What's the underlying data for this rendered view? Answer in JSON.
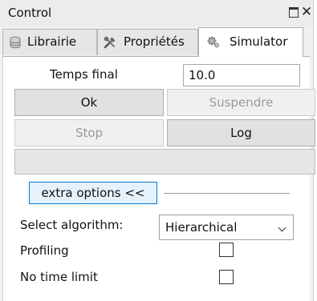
{
  "window": {
    "title": "Control",
    "float_icon": "float-window-icon",
    "close_glyph": "✕",
    "close_icon": "close-icon"
  },
  "tabs": [
    {
      "label": "Librairie",
      "icon": "database-icon",
      "active": false
    },
    {
      "label": "Propriétés",
      "icon": "tools-icon",
      "active": false
    },
    {
      "label": "Simulator",
      "icon": "gears-icon",
      "active": true
    }
  ],
  "simulator": {
    "final_time_label": "Temps final",
    "final_time_value": "10.0",
    "ok_label": "Ok",
    "suspend_label": "Suspendre",
    "stop_label": "Stop",
    "log_label": "Log",
    "progress": 0,
    "extra_options_label": "extra options <<",
    "algorithm_label": "Select algorithm:",
    "algorithm_value": "Hierarchical",
    "profiling_label": "Profiling",
    "profiling_checked": false,
    "no_time_limit_label": "No time limit",
    "no_time_limit_checked": false
  },
  "colors": {
    "accent": "#0078d7",
    "disabled_text": "#9a9a9a",
    "progress_fill": "#06b025"
  }
}
